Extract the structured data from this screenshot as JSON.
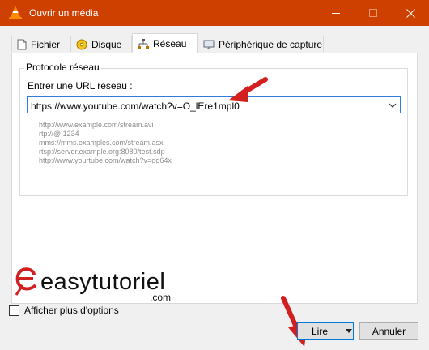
{
  "window": {
    "title": "Ouvrir un média",
    "accent": "#cd4000"
  },
  "tabs": [
    {
      "label": "Fichier",
      "icon": "file-icon"
    },
    {
      "label": "Disque",
      "icon": "disc-icon"
    },
    {
      "label": "Réseau",
      "icon": "network-icon",
      "active": true
    },
    {
      "label": "Périphérique de capture",
      "icon": "capture-device-icon"
    }
  ],
  "network": {
    "group_title": "Protocole réseau",
    "url_label": "Entrer une URL réseau :",
    "url_value": "https://www.youtube.com/watch?v=O_lEre1mpl0",
    "examples": [
      "http://www.example.com/stream.avi",
      "rtp://@:1234",
      "mms://mms.examples.com/stream.asx",
      "rtsp://server.example.org:8080/test.sdp",
      "http://www.yourtube.com/watch?v=gg64x"
    ]
  },
  "watermark": {
    "text": "easytutoriel",
    "suffix": ".com"
  },
  "footer": {
    "more_options_label": "Afficher plus d'options",
    "play_label": "Lire",
    "cancel_label": "Annuler"
  }
}
